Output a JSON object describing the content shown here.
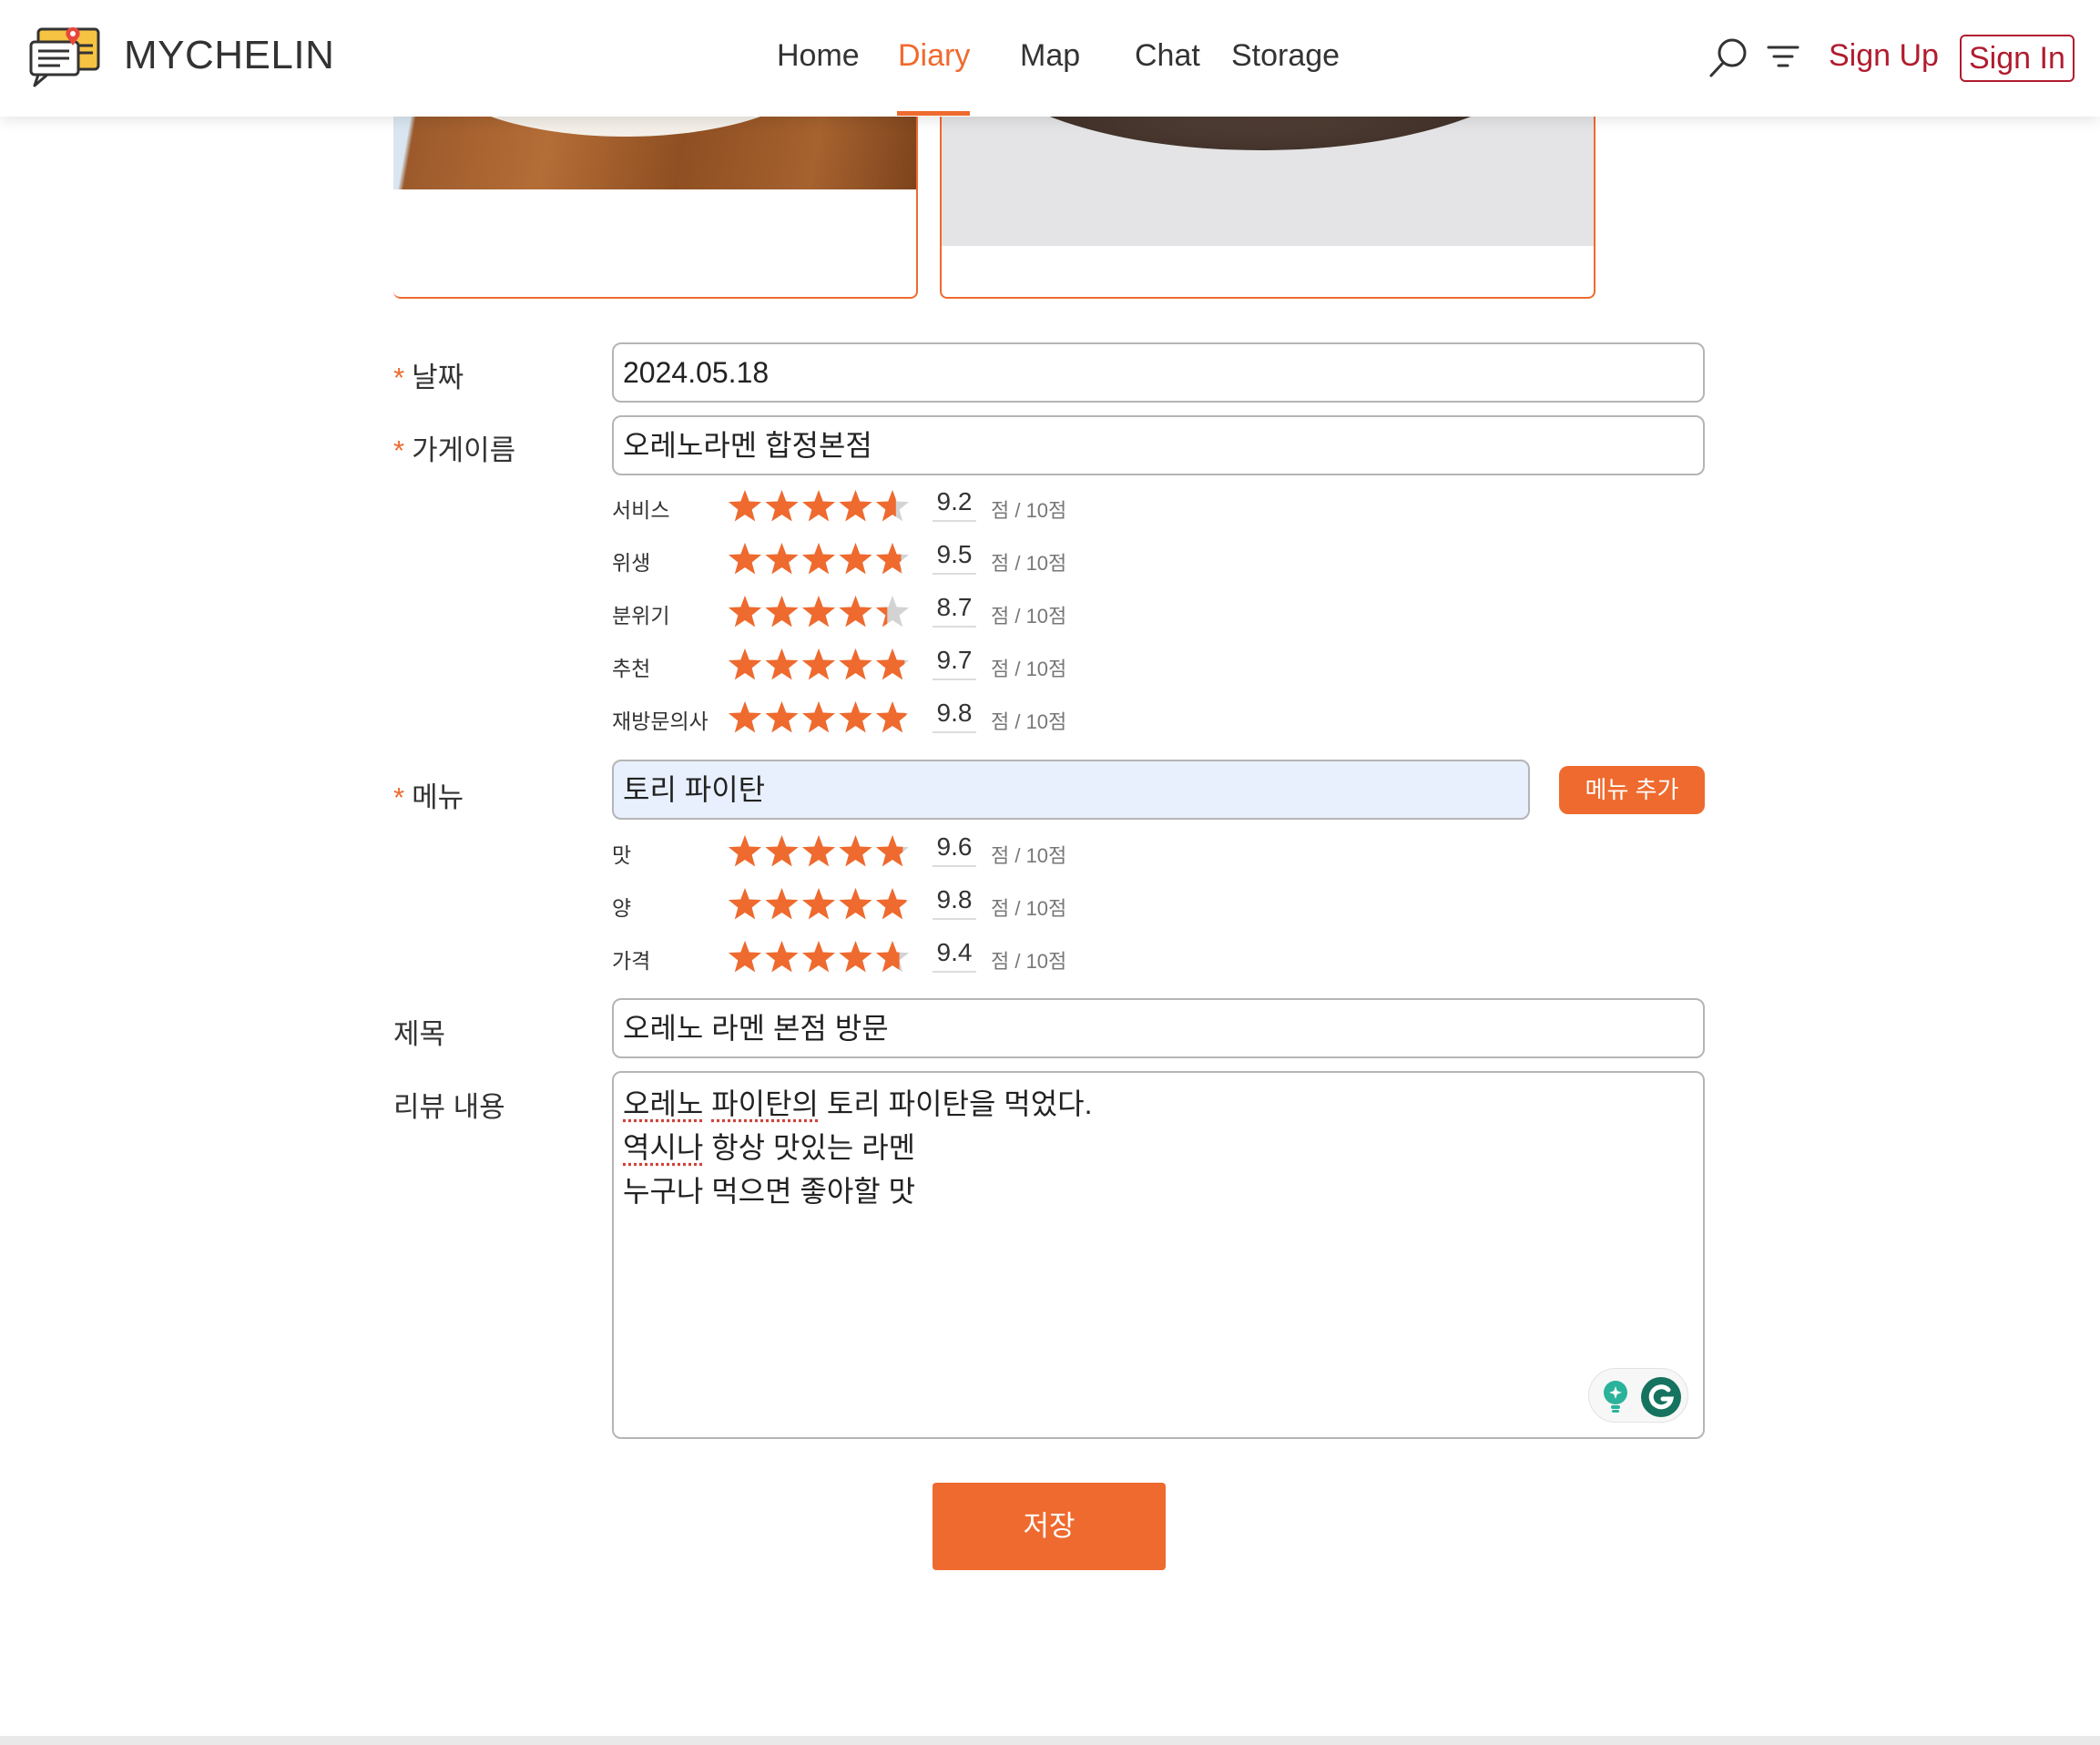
{
  "header": {
    "brand": "MYCHELIN",
    "nav": [
      {
        "label": "Home",
        "active": false
      },
      {
        "label": "Diary",
        "active": true
      },
      {
        "label": "Map",
        "active": false
      },
      {
        "label": "Chat",
        "active": false
      },
      {
        "label": "Storage",
        "active": false
      }
    ],
    "sign_up": "Sign Up",
    "sign_in": "Sign In"
  },
  "colors": {
    "accent": "#ef6a2e",
    "auth": "#b01c2e",
    "star_empty": "#d3d3d3"
  },
  "form": {
    "required_mark": "*",
    "date": {
      "label": "날짜",
      "value": "2024.05.18"
    },
    "store": {
      "label": "가게이름",
      "value": "오레노라멘 합정본점"
    },
    "store_ratings": [
      {
        "label": "서비스",
        "score": "9.2",
        "fraction": 0.92
      },
      {
        "label": "위생",
        "score": "9.5",
        "fraction": 0.95
      },
      {
        "label": "분위기",
        "score": "8.7",
        "fraction": 0.87
      },
      {
        "label": "추천",
        "score": "9.7",
        "fraction": 0.97
      },
      {
        "label": "재방문의사",
        "score": "9.8",
        "fraction": 0.98
      }
    ],
    "menu": {
      "label": "메뉴",
      "value": "토리 파이탄",
      "add_button": "메뉴 추가"
    },
    "menu_ratings": [
      {
        "label": "맛",
        "score": "9.6",
        "fraction": 0.96
      },
      {
        "label": "양",
        "score": "9.8",
        "fraction": 0.98
      },
      {
        "label": "가격",
        "score": "9.4",
        "fraction": 0.94
      }
    ],
    "score_unit": "점 / 10점",
    "title": {
      "label": "제목",
      "value": "오레노 라멘 본점 방문"
    },
    "review": {
      "label": "리뷰 내용",
      "lines": [
        [
          {
            "text": "오레노",
            "flag": true
          },
          {
            "text": " ",
            "flag": false
          },
          {
            "text": "파이탄의",
            "flag": true
          },
          {
            "text": " 토리 파이탄을 먹었다.",
            "flag": false
          }
        ],
        [
          {
            "text": "역시나",
            "flag": true
          },
          {
            "text": " 항상 맛있는 라멘",
            "flag": false
          }
        ],
        [
          {
            "text": "누구나 먹으면 좋아할 맛",
            "flag": false
          }
        ]
      ]
    },
    "save_button": "저장"
  }
}
